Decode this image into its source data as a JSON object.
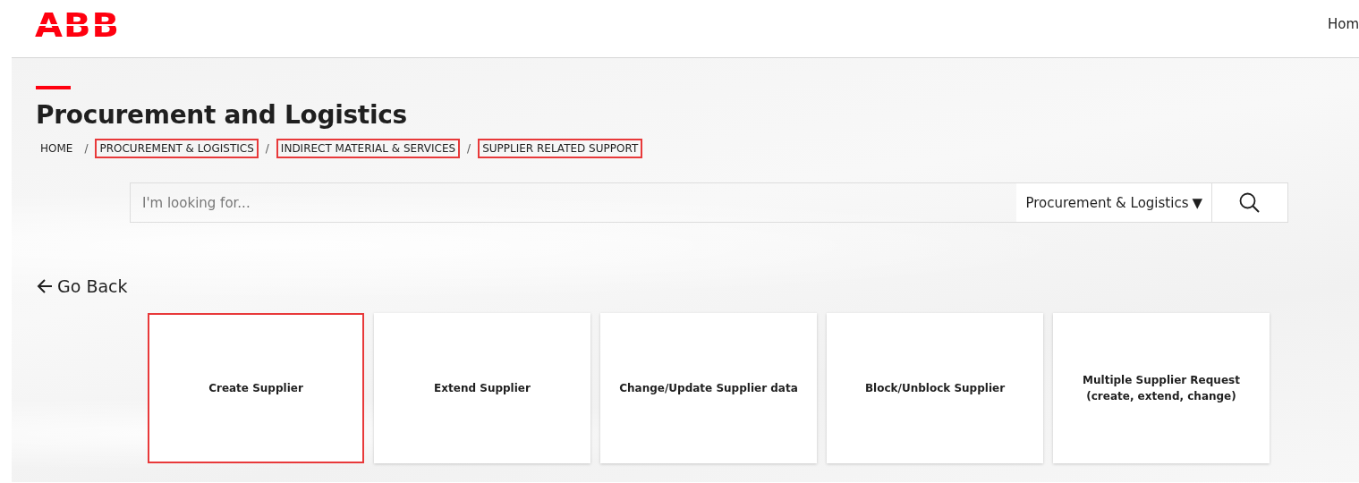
{
  "header": {
    "logo": "ABB",
    "nav_link": "Hom"
  },
  "page": {
    "title": "Procurement and Logistics",
    "breadcrumbs": [
      {
        "label": "HOME",
        "highlighted": false
      },
      {
        "label": "PROCUREMENT & LOGISTICS",
        "highlighted": true
      },
      {
        "label": "INDIRECT MATERIAL & SERVICES",
        "highlighted": true
      },
      {
        "label": "SUPPLIER RELATED SUPPORT",
        "highlighted": true
      }
    ],
    "breadcrumb_separator": "/",
    "search": {
      "placeholder": "I'm looking for...",
      "scope": "Procurement & Logistics",
      "scope_caret": "▼"
    },
    "back_link": "Go Back",
    "tiles": [
      {
        "label": "Create Supplier",
        "highlighted": true
      },
      {
        "label": "Extend Supplier",
        "highlighted": false
      },
      {
        "label": "Change/Update Supplier data",
        "highlighted": false
      },
      {
        "label": "Block/Unblock Supplier",
        "highlighted": false
      },
      {
        "label": "Multiple Supplier Request (create, extend, change)",
        "highlighted": false
      }
    ]
  }
}
